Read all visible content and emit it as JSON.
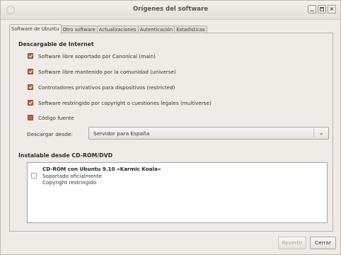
{
  "window": {
    "title": "Orígenes del software"
  },
  "tabs": [
    {
      "label": "Software de Ubuntu"
    },
    {
      "label": "Otro software"
    },
    {
      "label": "Actualizaciones"
    },
    {
      "label": "Autenticación"
    },
    {
      "label": "Estadísticas"
    }
  ],
  "internet": {
    "heading": "Descargable de Internet",
    "items": [
      {
        "label": "Software libre soportado por Canonical (main)",
        "checked": true
      },
      {
        "label": "Software libre mantenido por la comunidad (universe)",
        "checked": true
      },
      {
        "label": "Controladores privativos para dispositivos (restricted)",
        "checked": true
      },
      {
        "label": "Software restringido por copyright o cuestiones legales (multiverse)",
        "checked": true
      },
      {
        "label": "Código fuente",
        "checked": false
      }
    ],
    "download_label": "Descargar desde:",
    "download_value": "Servidor para España"
  },
  "cdrom": {
    "heading": "Instalable desde CD-ROM/DVD",
    "entry": {
      "title": "CD-ROM con Ubuntu 9.10 «Karmic Koala»",
      "line1": "Soportado oficialmente",
      "line2": "Copyright restringido",
      "checked": false
    }
  },
  "buttons": {
    "revert": "Revertir",
    "close": "Cerrar"
  },
  "colors": {
    "accent_checkbox": "#b8673f",
    "window_bg": "#efebe7"
  }
}
